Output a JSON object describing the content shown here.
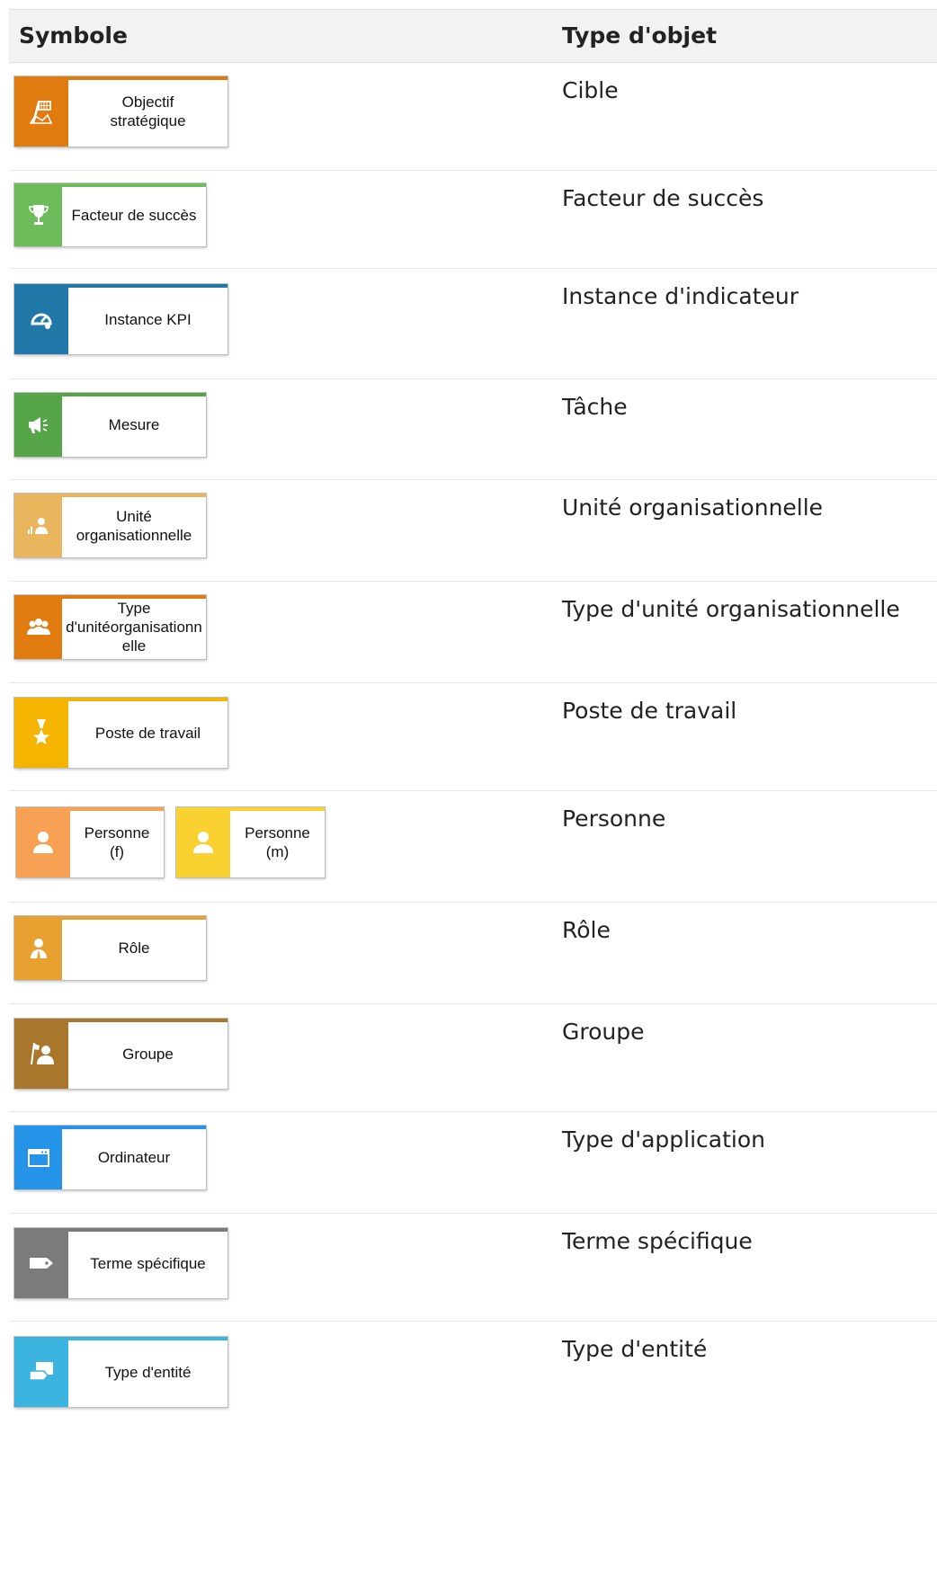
{
  "header": {
    "symbol": "Symbole",
    "type": "Type d'objet"
  },
  "rows": [
    {
      "label": "Objectif\nstratégique",
      "type": "Cible",
      "color": "#e07b10",
      "icon": "flag-icon"
    },
    {
      "label": "Facteur de succès",
      "type": "Facteur de succès",
      "color": "#6dbb5a",
      "icon": "trophy-icon"
    },
    {
      "label": "Instance KPI",
      "type": "Instance d'indicateur",
      "color": "#1f78a8",
      "icon": "gauge-icon"
    },
    {
      "label": "Mesure",
      "type": "Tâche",
      "color": "#55a447",
      "icon": "megaphone-icon"
    },
    {
      "label": "Unité\norganisationnelle",
      "type": "Unité organisationnelle",
      "color": "#e9b65e",
      "icon": "org-unit-icon"
    },
    {
      "label": "Type\nd'unitéorganisationn\nelle",
      "type": "Type d'unité organisationnelle",
      "color": "#e07b10",
      "icon": "org-unit-type-icon"
    },
    {
      "label": "Poste de travail",
      "type": "Poste de travail",
      "color": "#f4b400",
      "icon": "position-star-icon"
    },
    {
      "label": "Personne\n(f)",
      "label2": "Personne\n(m)",
      "type": "Personne",
      "color": "#f7a155",
      "color2": "#f9d231",
      "icon": "person-icon"
    },
    {
      "label": "Rôle",
      "type": "Rôle",
      "color": "#e8a131",
      "icon": "role-icon"
    },
    {
      "label": "Groupe",
      "type": "Groupe",
      "color": "#a8772c",
      "icon": "group-icon"
    },
    {
      "label": "Ordinateur",
      "type": "Type d'application",
      "color": "#2594e8",
      "icon": "window-icon"
    },
    {
      "label": "Terme spécifique",
      "type": "Terme spécifique",
      "color": "#7b7b7b",
      "icon": "tag-icon"
    },
    {
      "label": "Type d'entité",
      "type": "Type d'entité",
      "color": "#3cb4e0",
      "icon": "entity-icon"
    }
  ]
}
